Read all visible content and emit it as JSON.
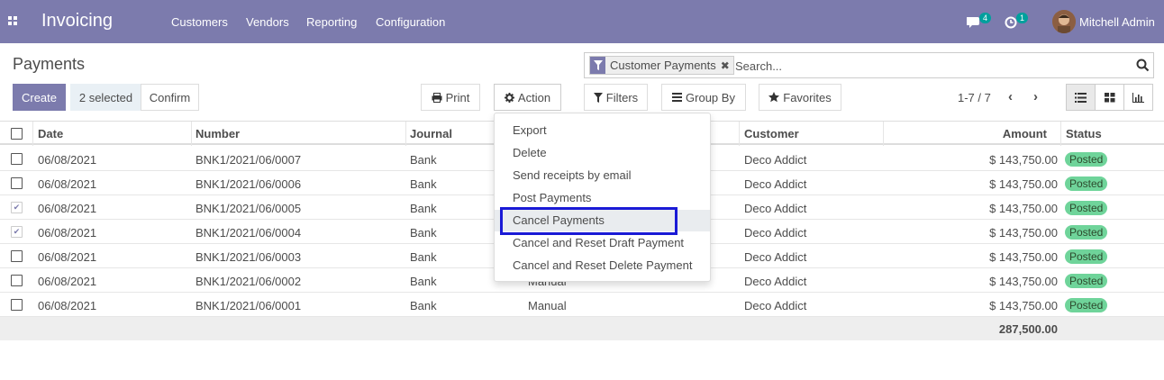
{
  "navbar": {
    "brand": "Invoicing",
    "menu": [
      "Customers",
      "Vendors",
      "Reporting",
      "Configuration"
    ],
    "messages_count": "4",
    "activities_count": "1",
    "user_name": "Mitchell Admin"
  },
  "page": {
    "title": "Payments"
  },
  "search": {
    "facet_label": "Customer Payments",
    "placeholder": "Search..."
  },
  "toolbar": {
    "create_label": "Create",
    "selected_label": "2 selected",
    "confirm_label": "Confirm",
    "print_label": "Print",
    "action_label": "Action",
    "filters_label": "Filters",
    "groupby_label": "Group By",
    "favorites_label": "Favorites",
    "pager": "1-7 / 7"
  },
  "action_menu": {
    "items": [
      "Export",
      "Delete",
      "Send receipts by email",
      "Post Payments",
      "Cancel Payments",
      "Cancel and Reset Draft Payment",
      "Cancel and Reset Delete Payment"
    ],
    "highlighted": "Cancel Payments"
  },
  "table": {
    "columns": [
      "Date",
      "Number",
      "Journal",
      "Customer",
      "Amount",
      "Status"
    ],
    "rows": [
      {
        "date": "06/08/2021",
        "number": "BNK1/2021/06/0007",
        "journal": "Bank",
        "method": "",
        "customer": "Deco Addict",
        "amount": "$ 143,750.00",
        "status": "Posted",
        "selected": false
      },
      {
        "date": "06/08/2021",
        "number": "BNK1/2021/06/0006",
        "journal": "Bank",
        "method": "",
        "customer": "Deco Addict",
        "amount": "$ 143,750.00",
        "status": "Posted",
        "selected": false
      },
      {
        "date": "06/08/2021",
        "number": "BNK1/2021/06/0005",
        "journal": "Bank",
        "method": "",
        "customer": "Deco Addict",
        "amount": "$ 143,750.00",
        "status": "Posted",
        "selected": true
      },
      {
        "date": "06/08/2021",
        "number": "BNK1/2021/06/0004",
        "journal": "Bank",
        "method": "",
        "customer": "Deco Addict",
        "amount": "$ 143,750.00",
        "status": "Posted",
        "selected": true
      },
      {
        "date": "06/08/2021",
        "number": "BNK1/2021/06/0003",
        "journal": "Bank",
        "method": "",
        "customer": "Deco Addict",
        "amount": "$ 143,750.00",
        "status": "Posted",
        "selected": false
      },
      {
        "date": "06/08/2021",
        "number": "BNK1/2021/06/0002",
        "journal": "Bank",
        "method": "Manual",
        "customer": "Deco Addict",
        "amount": "$ 143,750.00",
        "status": "Posted",
        "selected": false
      },
      {
        "date": "06/08/2021",
        "number": "BNK1/2021/06/0001",
        "journal": "Bank",
        "method": "Manual",
        "customer": "Deco Addict",
        "amount": "$ 143,750.00",
        "status": "Posted",
        "selected": false
      }
    ],
    "total": "287,500.00"
  },
  "colors": {
    "brand": "#7c7bad",
    "posted": "#6fd49a",
    "focus": "#1a1ad6"
  },
  "icons": [
    "apps-icon",
    "chat-icon",
    "clock-icon",
    "filter-icon",
    "remove-icon",
    "search-icon",
    "print-icon",
    "gear-icon",
    "filter-icon",
    "list-icon",
    "star-icon",
    "chevron-left-icon",
    "chevron-right-icon",
    "list-view-icon",
    "kanban-view-icon",
    "graph-view-icon"
  ]
}
